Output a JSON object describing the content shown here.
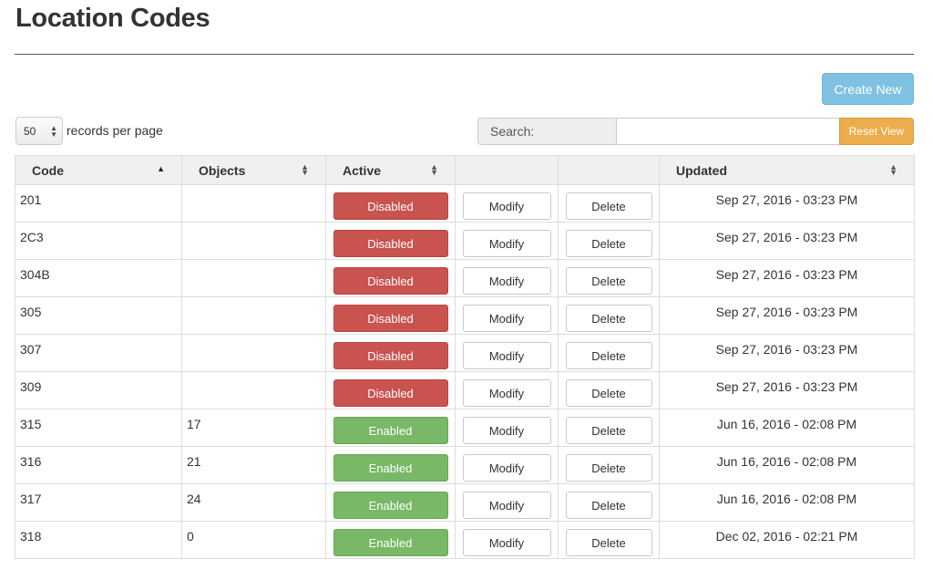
{
  "header": {
    "title": "Location Codes"
  },
  "toolbar": {
    "create_label": "Create New",
    "per_page_value": "50",
    "per_page_label": "records per page",
    "search_label": "Search:",
    "search_value": "",
    "reset_label": "Reset View"
  },
  "table": {
    "columns": [
      "Code",
      "Objects",
      "Active",
      "",
      "",
      "Updated"
    ],
    "sort": {
      "column": "Code",
      "direction": "ascending"
    },
    "rows": [
      {
        "code": "201",
        "objects": "",
        "active": "Disabled",
        "modify": "Modify",
        "delete": "Delete",
        "updated": "Sep 27, 2016 - 03:23 PM"
      },
      {
        "code": "2C3",
        "objects": "",
        "active": "Disabled",
        "modify": "Modify",
        "delete": "Delete",
        "updated": "Sep 27, 2016 - 03:23 PM"
      },
      {
        "code": "304B",
        "objects": "",
        "active": "Disabled",
        "modify": "Modify",
        "delete": "Delete",
        "updated": "Sep 27, 2016 - 03:23 PM"
      },
      {
        "code": "305",
        "objects": "",
        "active": "Disabled",
        "modify": "Modify",
        "delete": "Delete",
        "updated": "Sep 27, 2016 - 03:23 PM"
      },
      {
        "code": "307",
        "objects": "",
        "active": "Disabled",
        "modify": "Modify",
        "delete": "Delete",
        "updated": "Sep 27, 2016 - 03:23 PM"
      },
      {
        "code": "309",
        "objects": "",
        "active": "Disabled",
        "modify": "Modify",
        "delete": "Delete",
        "updated": "Sep 27, 2016 - 03:23 PM"
      },
      {
        "code": "315",
        "objects": "17",
        "active": "Enabled",
        "modify": "Modify",
        "delete": "Delete",
        "updated": "Jun 16, 2016 - 02:08 PM"
      },
      {
        "code": "316",
        "objects": "21",
        "active": "Enabled",
        "modify": "Modify",
        "delete": "Delete",
        "updated": "Jun 16, 2016 - 02:08 PM"
      },
      {
        "code": "317",
        "objects": "24",
        "active": "Enabled",
        "modify": "Modify",
        "delete": "Delete",
        "updated": "Jun 16, 2016 - 02:08 PM"
      },
      {
        "code": "318",
        "objects": "0",
        "active": "Enabled",
        "modify": "Modify",
        "delete": "Delete",
        "updated": "Dec 02, 2016 - 02:21 PM"
      }
    ]
  },
  "colors": {
    "create_button": "#7fc1e3",
    "reset_button": "#ecad4e",
    "disabled_status": "#c9534f",
    "enabled_status": "#78b866",
    "header_bg": "#f0f0f0"
  },
  "icons": {
    "sort_ascending": "sort-ascending-icon",
    "sortable": "sort-both-icon",
    "select_arrows": "select-arrows-icon"
  }
}
